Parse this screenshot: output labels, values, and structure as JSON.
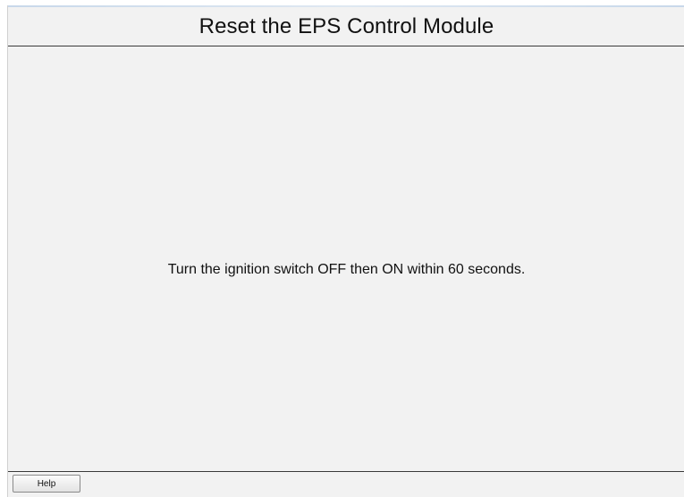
{
  "header": {
    "title": "Reset the EPS Control Module"
  },
  "main": {
    "instruction": "Turn the ignition switch OFF then ON within 60 seconds."
  },
  "footer": {
    "help_label": "Help"
  },
  "colors": {
    "background": "#f2f2f2",
    "divider": "#3a3a3a",
    "text": "#111111"
  }
}
